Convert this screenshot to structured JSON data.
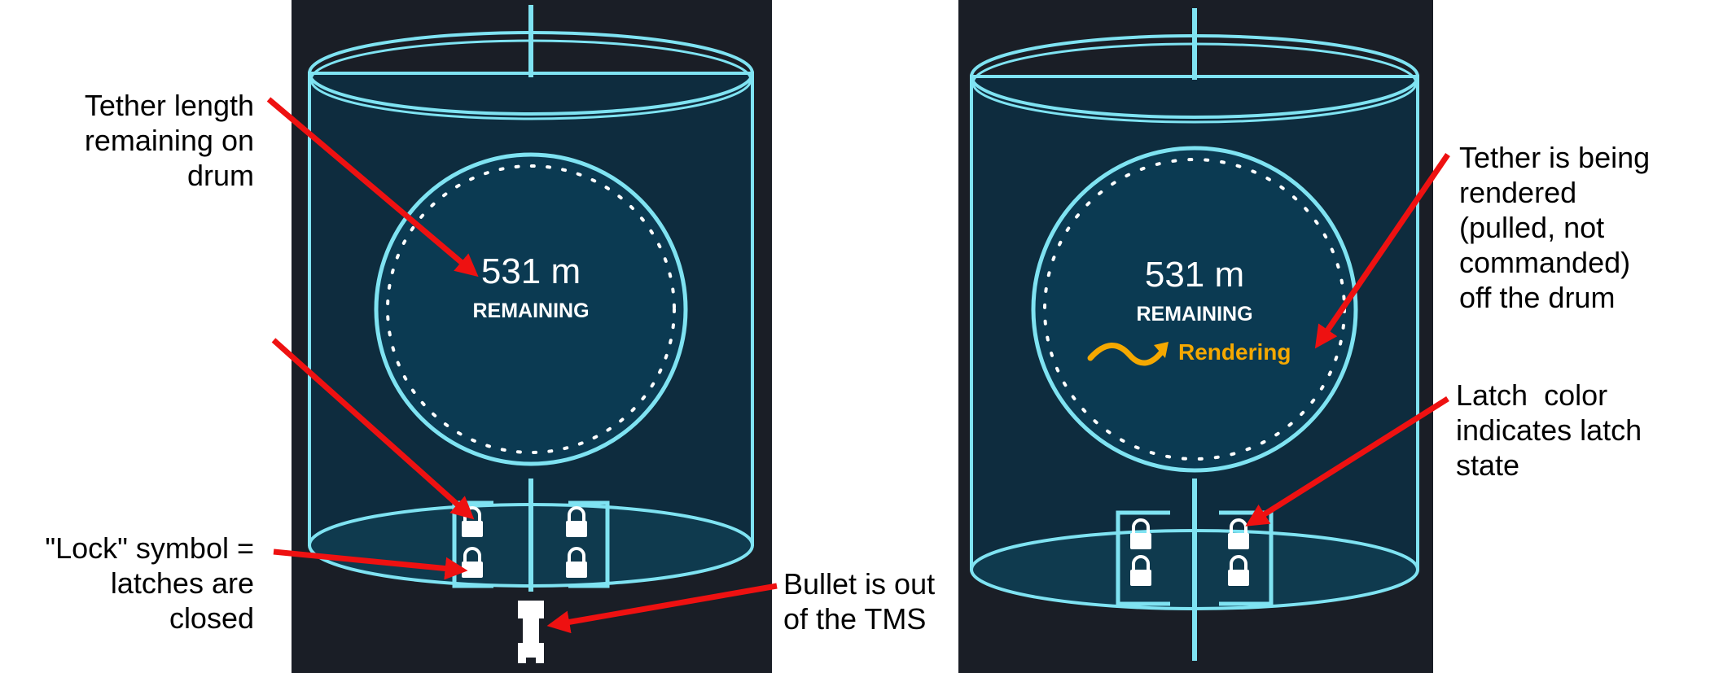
{
  "colors": {
    "panel_bg": "#1a1e26",
    "drum_fill": "#0e2c3e",
    "outline": "#7fe3f2",
    "status_orange": "#f5a800",
    "arrow_red": "#ee1111",
    "text_white": "#ffffff"
  },
  "left_display": {
    "value": "531 m",
    "label": "REMAINING",
    "latch_icon": "padlock-icon",
    "bullet_icon": "bullet-icon"
  },
  "right_display": {
    "value": "531 m",
    "label": "REMAINING",
    "status": "Rendering",
    "status_icon": "wave-arrow-icon",
    "latch_icon": "padlock-icon"
  },
  "callouts": {
    "tether_length": "Tether length\nremaining on\ndrum",
    "lock_symbol": "\"Lock\" symbol =\nlatches are\nclosed",
    "bullet_out": "Bullet is out\nof the TMS",
    "rendering": "Tether is being\nrendered\n(pulled, not\ncommanded)\noff the drum",
    "latch_color": "Latch  color\nindicates latch\nstate"
  }
}
